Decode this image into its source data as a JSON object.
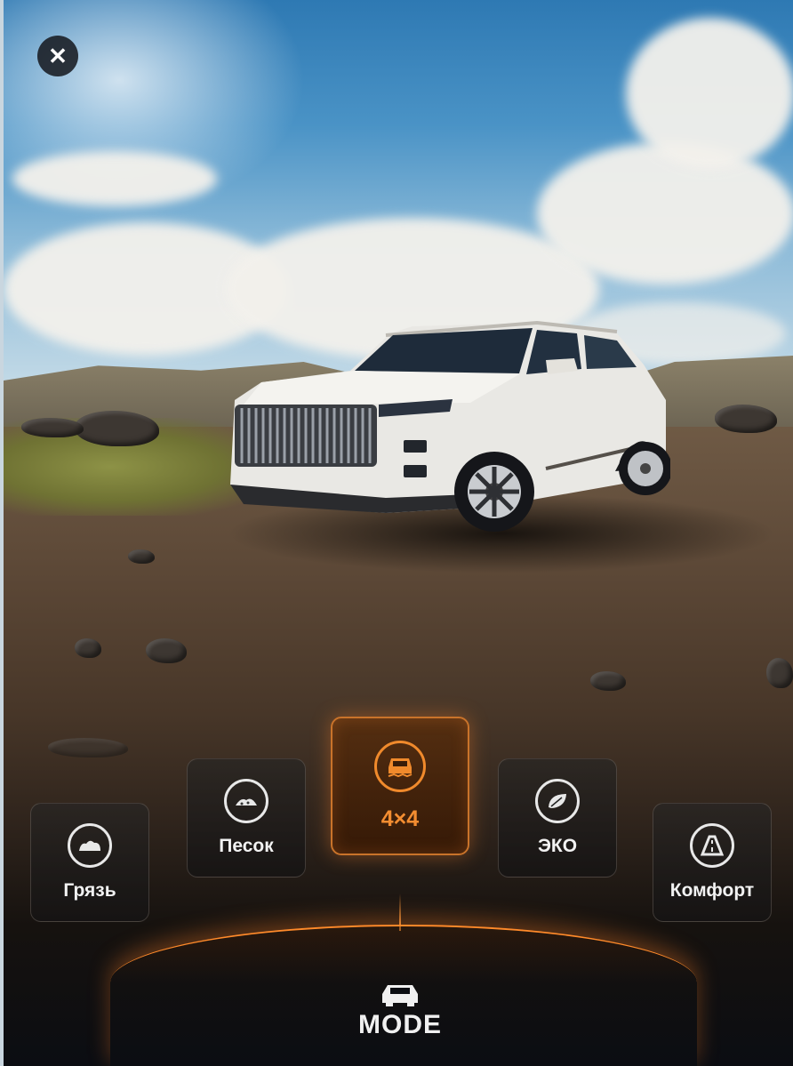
{
  "close": {
    "icon": "close-icon"
  },
  "modes": [
    {
      "id": "mud",
      "label": "Грязь",
      "icon": "mud-icon",
      "active": false
    },
    {
      "id": "sand",
      "label": "Песок",
      "icon": "sand-icon",
      "active": false
    },
    {
      "id": "4x4",
      "label": "4×4",
      "icon": "offroad-car-icon",
      "active": true
    },
    {
      "id": "eco",
      "label": "ЭКО",
      "icon": "eco-leaf-icon",
      "active": false
    },
    {
      "id": "comfort",
      "label": "Комфорт",
      "icon": "road-icon",
      "active": false
    }
  ],
  "footer": {
    "icon": "car-icon",
    "title": "MODE"
  },
  "colors": {
    "accent": "#f38d31",
    "tile_border": "#8c8278",
    "background": "#0b0d12"
  }
}
